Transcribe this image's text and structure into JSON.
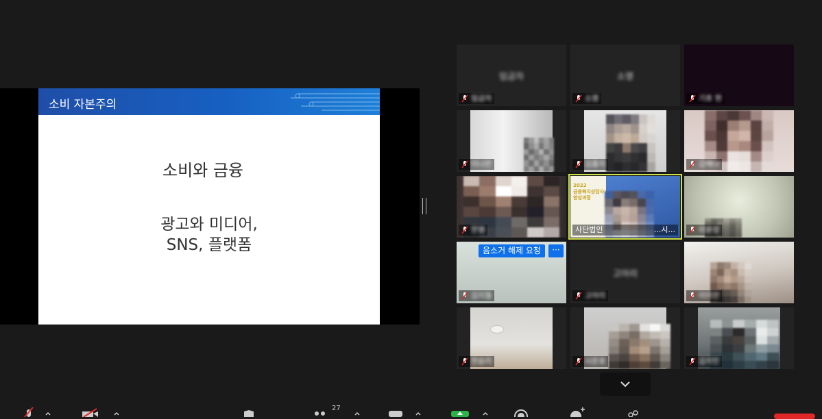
{
  "share": {
    "slide_title": "소비 자본주의",
    "line1": "소비와 금융",
    "line2a": "광고와 미디어,",
    "line2b": "SNS, 플랫폼"
  },
  "gallery": {
    "tiles": [
      {
        "center": "임금자",
        "name": "임금자"
      },
      {
        "center": "소영",
        "name": "소영"
      },
      {
        "center": "",
        "name": "기호 현"
      },
      {
        "name": "이나은"
      },
      {
        "name": "김홍지"
      },
      {
        "name": "김해나"
      },
      {
        "name": "한영"
      },
      {
        "name": "사단법인 ",
        "name_tail": "...시..."
      },
      {
        "name": "이윤정"
      },
      {
        "name": "김지철"
      },
      {
        "center": "고아리",
        "name": "고아리"
      },
      {
        "name": "이이선"
      },
      {
        "name": "전승리"
      },
      {
        "name": "시온호"
      },
      {
        "name": "김지민"
      }
    ],
    "unmute_request": "음소거 해제 요청",
    "more": "···",
    "participants_count": "27"
  },
  "colors": {
    "accent_active": "#cfe14a",
    "request_blue": "#0e71eb",
    "end_red": "#e02828"
  }
}
